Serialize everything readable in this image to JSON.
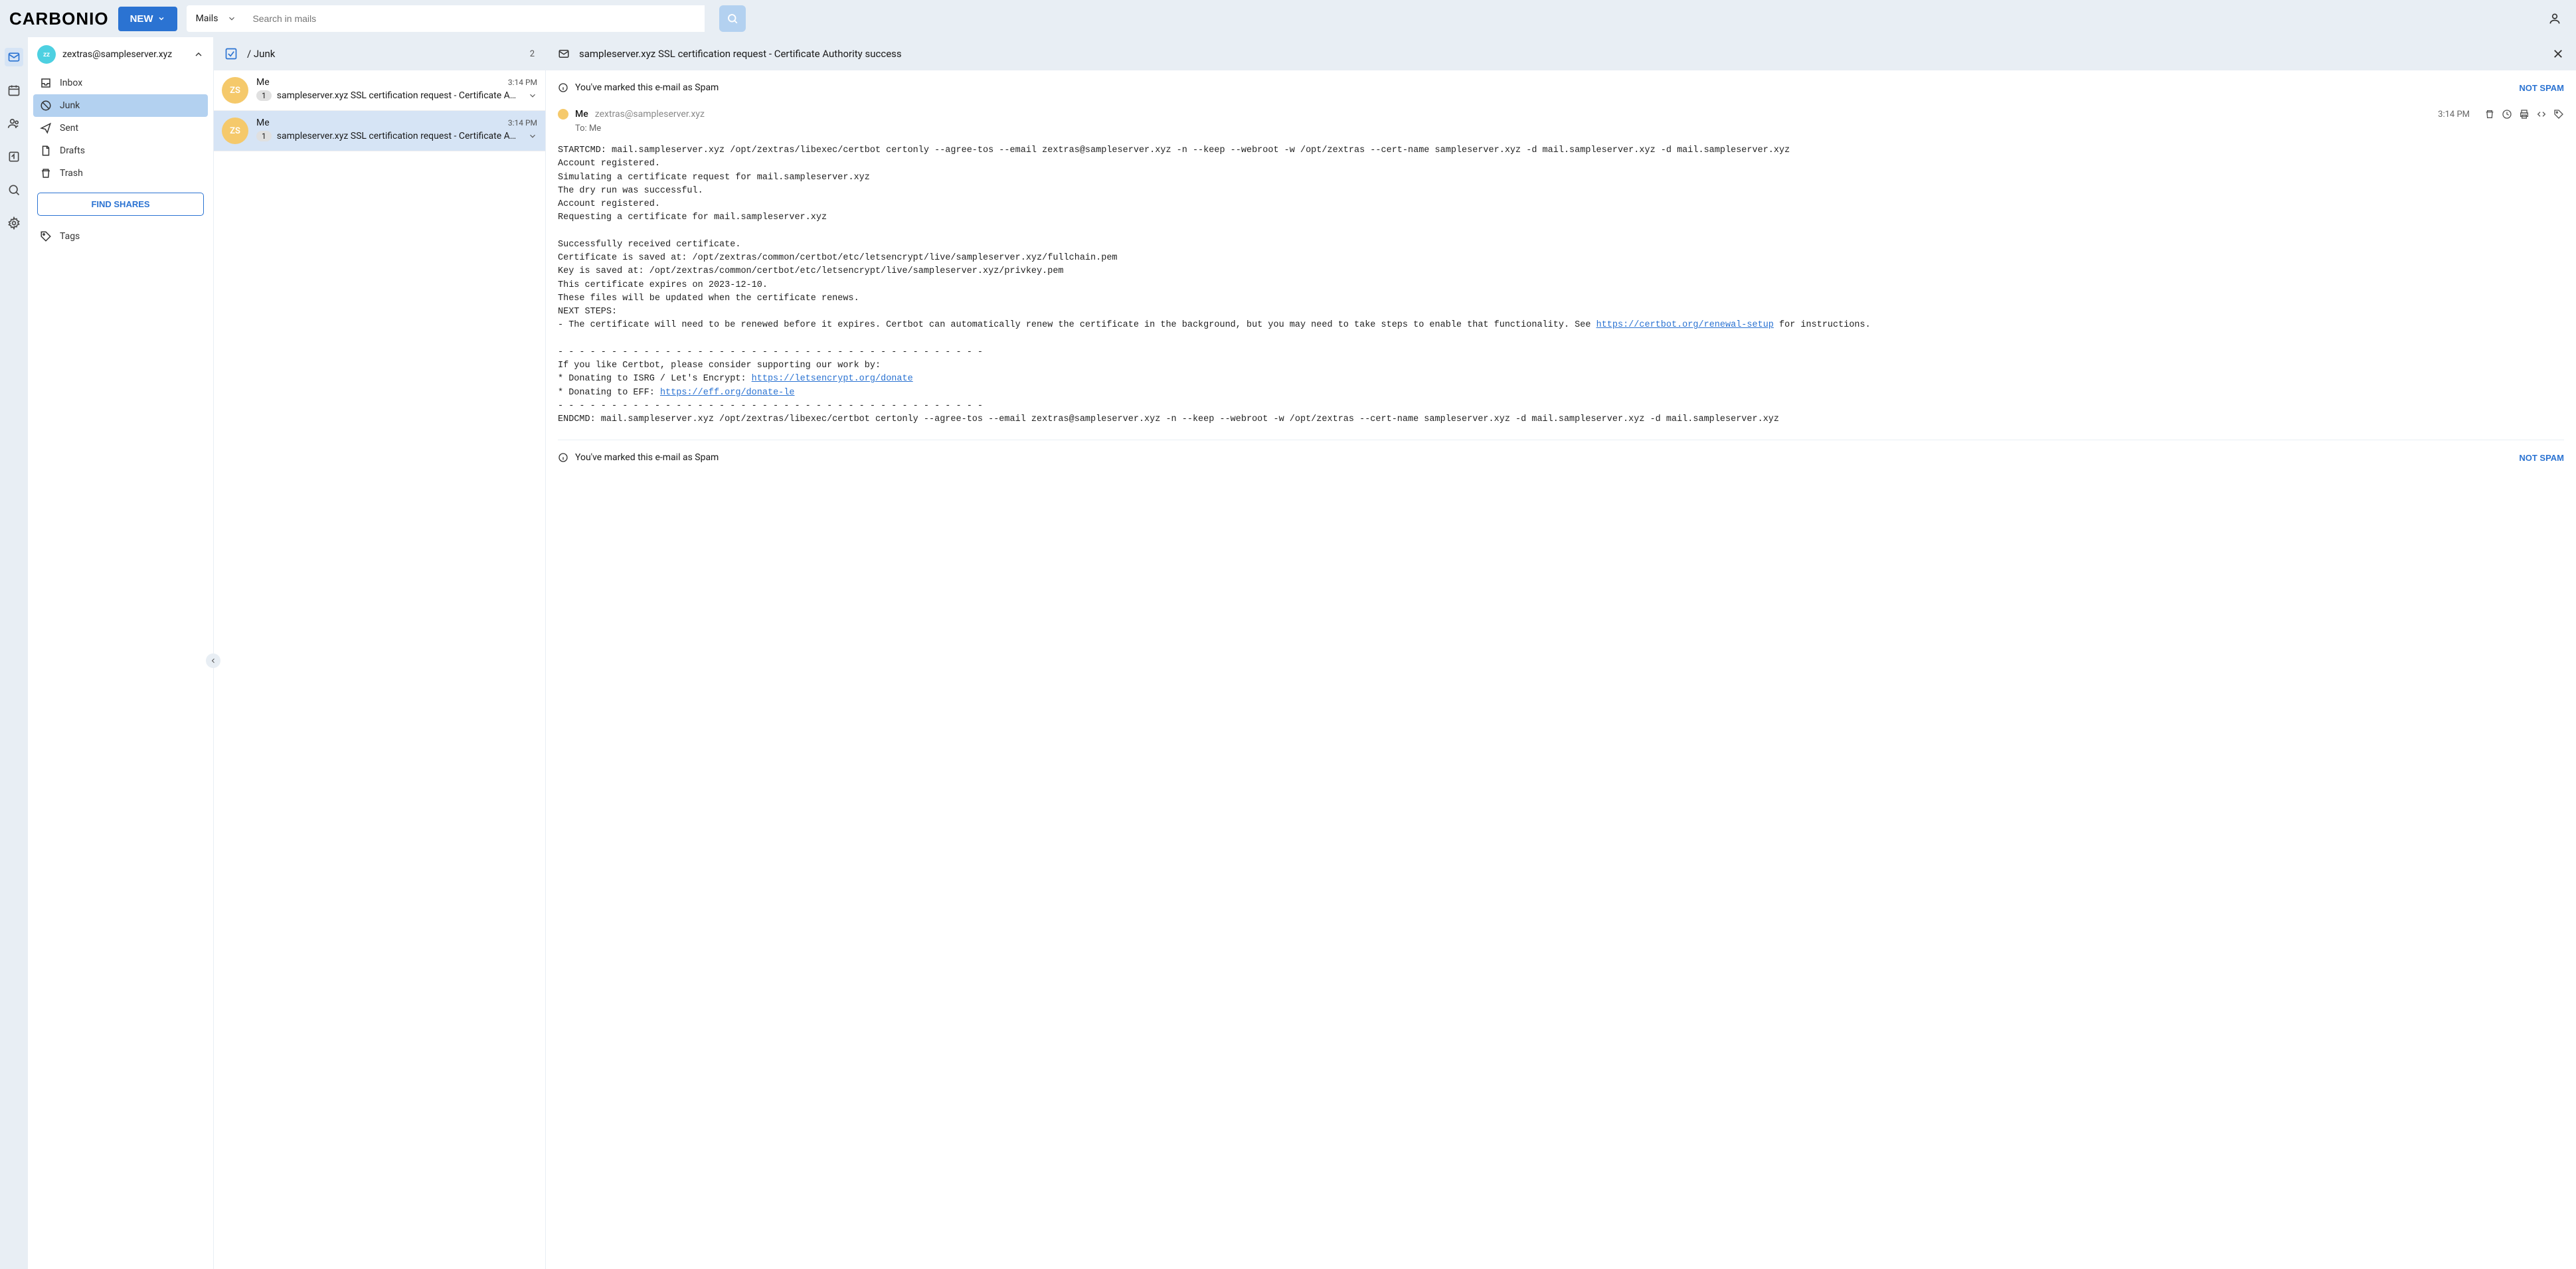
{
  "brand": "CARBONIO",
  "topbar": {
    "new_label": "NEW",
    "search_scope": "Mails",
    "search_placeholder": "Search in mails"
  },
  "account": {
    "initials": "zz",
    "email": "zextras@sampleserver.xyz"
  },
  "folders": [
    {
      "key": "inbox",
      "label": "Inbox"
    },
    {
      "key": "junk",
      "label": "Junk"
    },
    {
      "key": "sent",
      "label": "Sent"
    },
    {
      "key": "drafts",
      "label": "Drafts"
    },
    {
      "key": "trash",
      "label": "Trash"
    }
  ],
  "find_shares_label": "FIND SHARES",
  "tags_label": "Tags",
  "list_header": {
    "path": "/ Junk",
    "count": "2"
  },
  "conversations": [
    {
      "avatar": "ZS",
      "sender": "Me",
      "time": "3:14 PM",
      "count": "1",
      "subject": "sampleserver.xyz SSL certification request - Certificate A…"
    },
    {
      "avatar": "ZS",
      "sender": "Me",
      "time": "3:14 PM",
      "count": "1",
      "subject": "sampleserver.xyz SSL certification request - Certificate A…"
    }
  ],
  "reader": {
    "subject": "sampleserver.xyz SSL certification request - Certificate Authority success",
    "spam_notice": "You've marked this e-mail as Spam",
    "not_spam_label": "NOT SPAM",
    "from_name": "Me",
    "from_email": "zextras@sampleserver.xyz",
    "to_label": "To:",
    "to_value": "Me",
    "time": "3:14 PM",
    "body_line_01": "STARTCMD: mail.sampleserver.xyz /opt/zextras/libexec/certbot certonly --agree-tos --email zextras@sampleserver.xyz -n --keep --webroot -w /opt/zextras --cert-name sampleserver.xyz -d mail.sampleserver.xyz -d mail.sampleserver.xyz",
    "body_line_02": "Account registered.",
    "body_line_03": "Simulating a certificate request for mail.sampleserver.xyz",
    "body_line_04": "The dry run was successful.",
    "body_line_05": "Account registered.",
    "body_line_06": "Requesting a certificate for mail.sampleserver.xyz",
    "body_line_07": "",
    "body_line_08": "Successfully received certificate.",
    "body_line_09": "Certificate is saved at: /opt/zextras/common/certbot/etc/letsencrypt/live/sampleserver.xyz/fullchain.pem",
    "body_line_10": "Key is saved at: /opt/zextras/common/certbot/etc/letsencrypt/live/sampleserver.xyz/privkey.pem",
    "body_line_11": "This certificate expires on 2023-12-10.",
    "body_line_12": "These files will be updated when the certificate renews.",
    "body_line_13": "NEXT STEPS:",
    "body_line_14a": "- The certificate will need to be renewed before it expires. Certbot can automatically renew the certificate in the background, but you may need to take steps to enable that functionality. See ",
    "body_link_14": "https://certbot.org/renewal-setup",
    "body_line_14b": " for instructions.",
    "body_line_15": "",
    "body_line_16": "- - - - - - - - - - - - - - - - - - - - - - - - - - - - - - - - - - - - - - - -",
    "body_line_17": "If you like Certbot, please consider supporting our work by:",
    "body_line_18a": "* Donating to ISRG / Let's Encrypt: ",
    "body_link_18": "https://letsencrypt.org/donate",
    "body_line_19a": "* Donating to EFF: ",
    "body_link_19": "https://eff.org/donate-le",
    "body_line_20": "- - - - - - - - - - - - - - - - - - - - - - - - - - - - - - - - - - - - - - - -",
    "body_line_21": "ENDCMD: mail.sampleserver.xyz /opt/zextras/libexec/certbot certonly --agree-tos --email zextras@sampleserver.xyz -n --keep --webroot -w /opt/zextras --cert-name sampleserver.xyz -d mail.sampleserver.xyz -d mail.sampleserver.xyz"
  }
}
